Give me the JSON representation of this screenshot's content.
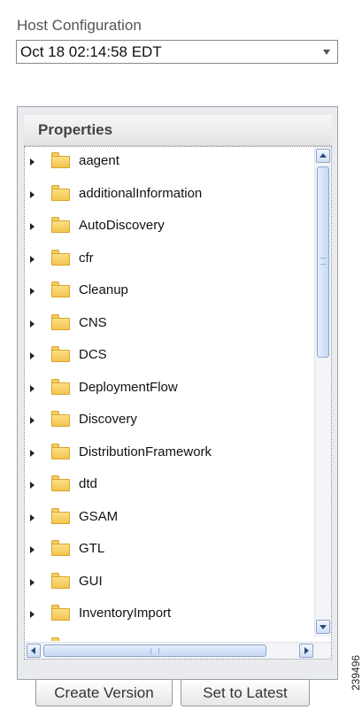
{
  "host_configuration": {
    "label": "Host Configuration",
    "selected_value": "Oct 18 02:14:58 EDT"
  },
  "properties": {
    "title": "Properties",
    "items": [
      "aagent",
      "additionalInformation",
      "AutoDiscovery",
      "cfr",
      "Cleanup",
      "CNS",
      "DCS",
      "DeploymentFlow",
      "Discovery",
      "DistributionFramework",
      "dtd",
      "GSAM",
      "GTL",
      "GUI",
      "InventoryImport"
    ]
  },
  "buttons": {
    "create_version": "Create Version",
    "set_to_latest": "Set to Latest"
  },
  "figure_id": "239496",
  "colors": {
    "folder": "#f3c24a",
    "scrollbar": "#c7d9f4",
    "panel_bg": "#e9ebee"
  }
}
